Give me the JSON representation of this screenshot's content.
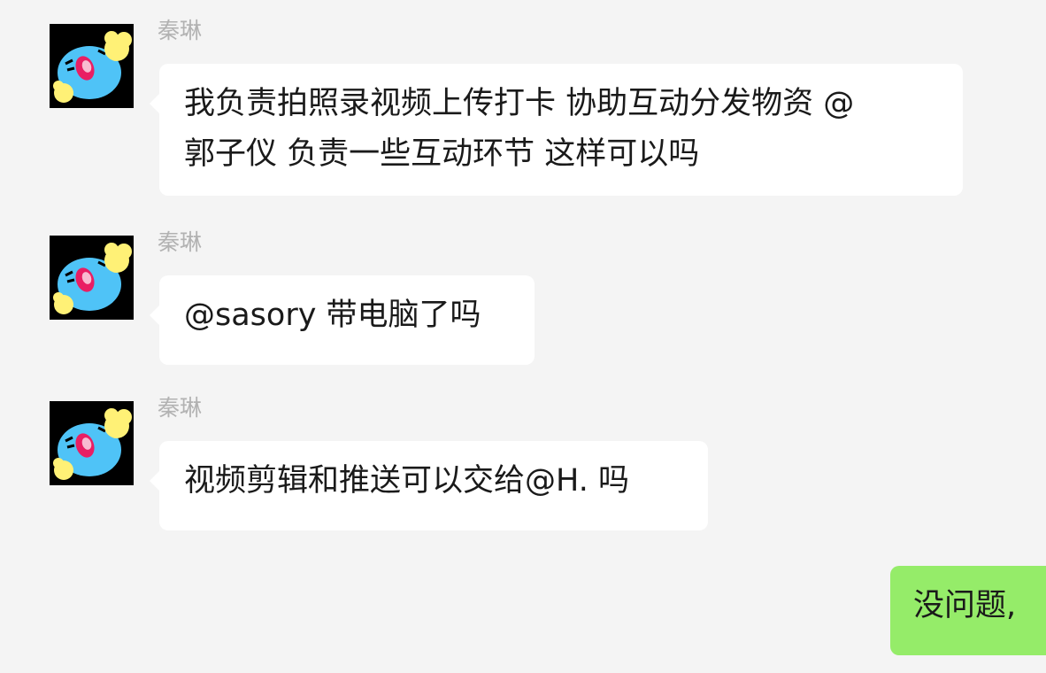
{
  "messages": [
    {
      "sender": "秦琳",
      "text": "我负责拍照录视频上传打卡 协助互动分发物资 @\n郭子仪 负责一些互动环节 这样可以吗"
    },
    {
      "sender": "秦琳",
      "text": "@sasory 带电脑了吗"
    },
    {
      "sender": "秦琳",
      "text": "视频剪辑和推送可以交给@H. 吗"
    },
    {
      "sender": "",
      "text": "没问题,"
    }
  ],
  "colors": {
    "background": "#f4f4f4",
    "incoming_bubble": "#ffffff",
    "outgoing_bubble": "#95ec69",
    "sender_name": "#b2b2b2"
  },
  "avatar_icon": "blue-cat-sticker-icon"
}
